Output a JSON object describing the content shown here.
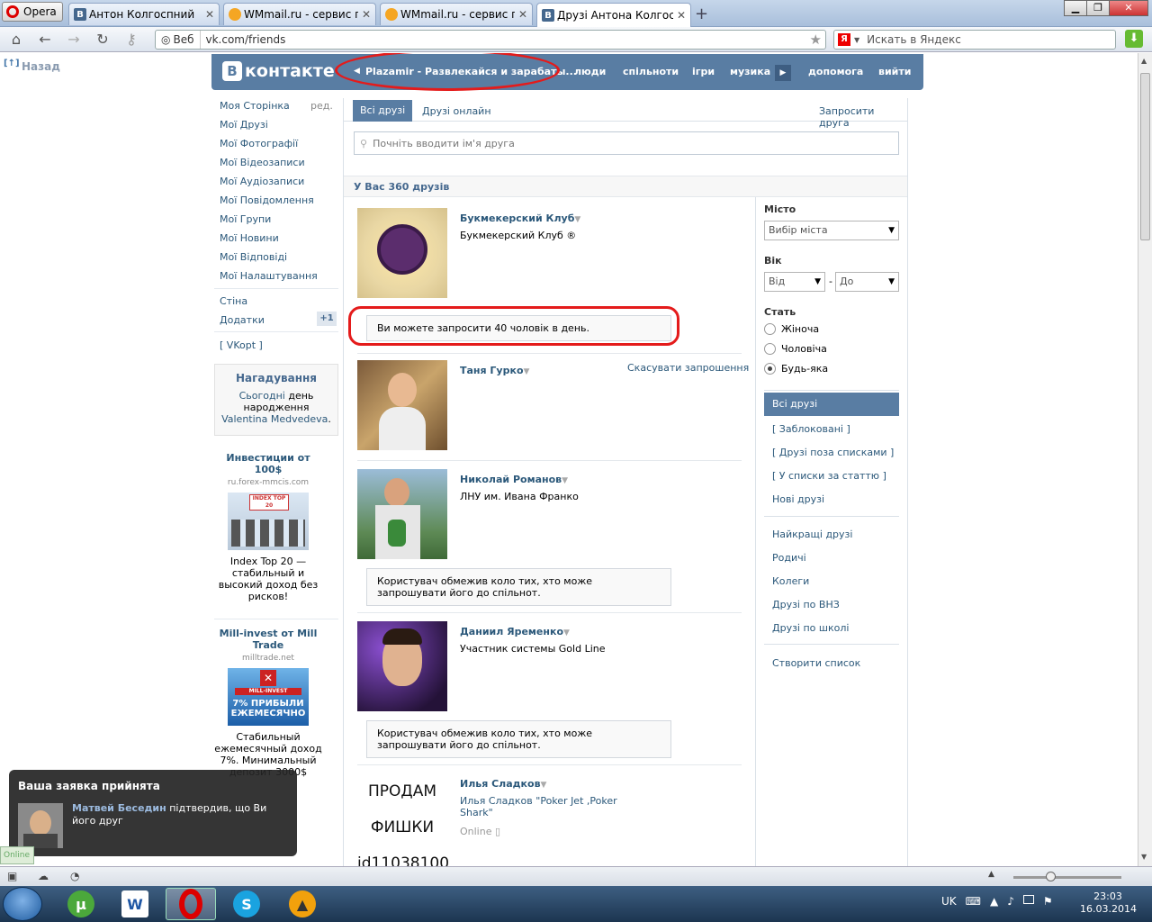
{
  "browser": {
    "menu_label": "Opera",
    "tabs": [
      {
        "label": "Антон Колгоспний",
        "icon": "vk-icon"
      },
      {
        "label": "WMmail.ru - сервис п...",
        "icon": "wmmail-icon"
      },
      {
        "label": "WMmail.ru - сервис п...",
        "icon": "wmmail-icon"
      },
      {
        "label": "Друзі Антона Колгосп...",
        "icon": "vk-icon"
      }
    ],
    "search_engine_label": "Веб",
    "url": "vk.com/friends",
    "search_placeholder": "Искать в Яндекс"
  },
  "page": {
    "back_label": "Назад",
    "header": {
      "logo_text": "контакте",
      "logo_letter": "В",
      "marquee": "Plazamir - Развлекайся и зарабаты...",
      "menu": [
        "люди",
        "спільноти",
        "ігри",
        "музика",
        "допомога",
        "вийти"
      ]
    },
    "left_nav": {
      "items": [
        "Моя Сторінка",
        "Мої Друзі",
        "Мої Фотографії",
        "Мої Відеозаписи",
        "Мої Аудіозаписи",
        "Мої Повідомлення",
        "Мої Групи",
        "Мої Новини",
        "Мої Відповіді",
        "Мої Налаштування"
      ],
      "edit_label": "ред.",
      "secondary": [
        "Стіна",
        "Додатки"
      ],
      "apps_badge": "+1",
      "vkopt": "[ VKopt ]"
    },
    "reminder": {
      "title": "Нагадування",
      "line1_link": "Сьогодні",
      "line1_rest": " день",
      "line2": "народження",
      "name": "Valentina Medvedeva",
      "suffix": "."
    },
    "ads": [
      {
        "title": "Инвестиции от 100$",
        "domain": "ru.forex-mmcis.com",
        "image_text": "INDEX TOP 20",
        "body": "Index Top 20 — стабильный и высокий доход без рисков!"
      },
      {
        "title": "Mill-invest от Mill Trade",
        "domain": "milltrade.net",
        "image_text": "7% ПРИБЫЛИ ЕЖЕМЕСЯЧНО",
        "image_brand": "MILL-INVEST",
        "body": "Стабильный ежемесячный доход 7%. Минимальный депозит 3000$"
      }
    ],
    "main": {
      "tab_all": "Всі друзі",
      "tab_online": "Друзі онлайн",
      "invite_link": "Запросити друга",
      "search_placeholder": "Почніть вводити ім'я друга",
      "count_text": "У Вас 360 друзів",
      "friends": [
        {
          "name": "Букмекерский Клуб",
          "sub": "Букмекерский Клуб ®"
        },
        {
          "name": "Таня Гурко",
          "sub": ""
        },
        {
          "name": "Николай Романов",
          "sub": "ЛНУ им. Ивана Франко"
        },
        {
          "name": "Даниил Яременко",
          "sub": "Участник системы Gold Line"
        },
        {
          "name": "Илья Сладков",
          "sub": "Илья Сладков \"Poker Jet ,Poker Shark\"",
          "status": "Online"
        }
      ],
      "invite_limit_note": "Ви можете запросити 40 чоловік в день.",
      "cancel_request": "Скасувати запрошення",
      "restricted_note": "Користувач обмежив коло тих, хто може запрошувати його до спільнот.",
      "photo_text_lines": [
        "ПРОДАМ",
        "ФИШКИ",
        "id11038100"
      ]
    },
    "filter": {
      "city_label": "Місто",
      "city_select": "Вибір міста",
      "age_label": "Вік",
      "age_from": "Від",
      "age_dash": "-",
      "age_to": "До",
      "sex_label": "Стать",
      "sex_options": [
        "Жіноча",
        "Чоловіча",
        "Будь-яка"
      ],
      "sex_selected": "Будь-яка",
      "lists_selected": "Всі друзі",
      "lists": [
        "[ Заблоковані ]",
        "[ Друзі поза списками ]",
        "[ У списки за статтю ]",
        "Нові друзі"
      ],
      "lists2": [
        "Найкращі друзі",
        "Родичі",
        "Колеги",
        "Друзі по ВНЗ",
        "Друзі по школі"
      ],
      "create_list": "Створити список"
    },
    "notification": {
      "title": "Ваша заявка прийнята",
      "name": "Матвей Беседин",
      "message": " підтвердив, що Ви його друг"
    },
    "online_tag": "Online"
  },
  "taskbar": {
    "lang": "UK",
    "time": "23:03",
    "date": "16.03.2014"
  },
  "colors": {
    "vk_blue": "#597da3",
    "link": "#2b587a",
    "annotation_red": "#e41b1b"
  }
}
